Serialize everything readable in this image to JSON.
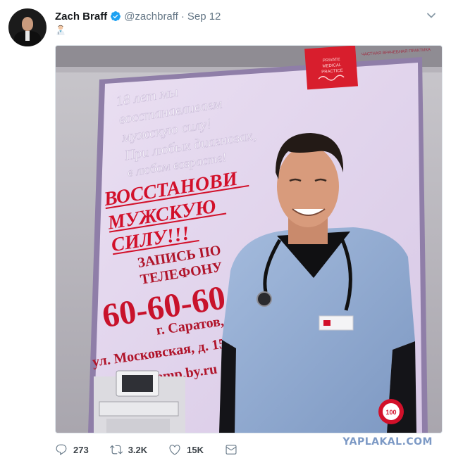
{
  "tweet": {
    "author_name": "Zach Braff",
    "handle": "@zachbraff",
    "separator": "·",
    "date": "Sep 12",
    "body_emoji": "doctor-emoji",
    "verified_color": "#1da1f2"
  },
  "poster": {
    "tagline_lines": [
      "18 лет мы",
      "восстанавливаем",
      "мужскую силу!",
      "При любых диагнозах,",
      "в любом возрасте!"
    ],
    "headline_lines": [
      "ВОССТАНОВИ",
      "МУЖСКУЮ",
      "СИЛУ!!!"
    ],
    "call_lines": [
      "ЗАПИСЬ ПО",
      "ТЕЛЕФОНУ"
    ],
    "phone": "60-60-60",
    "city": "г. Саратов,",
    "street": "ул. Московская, д. 152",
    "site": "www.emp.by.ru",
    "logo_lines": [
      "PRIVATE",
      "MEDICAL",
      "PRACTICE"
    ],
    "logo_caption": "ЧАСТНАЯ ВРАЧЕБНАЯ ПРАКТИКА",
    "badge_text": "100"
  },
  "actions": {
    "replies": "273",
    "retweets": "3.2K",
    "likes": "15K"
  },
  "watermark": "YAPLAKAL.COM",
  "icons": {
    "verified": "verified-badge-icon",
    "more": "chevron-down-icon",
    "reply": "reply-icon",
    "retweet": "retweet-icon",
    "like": "heart-icon",
    "dm": "envelope-icon"
  },
  "colors": {
    "text": "#14171a",
    "muted": "#657786",
    "accent": "#1da1f2",
    "poster_bg": "#e2d7ec",
    "poster_red": "#d2102a",
    "scrubs": "#8faad0"
  }
}
